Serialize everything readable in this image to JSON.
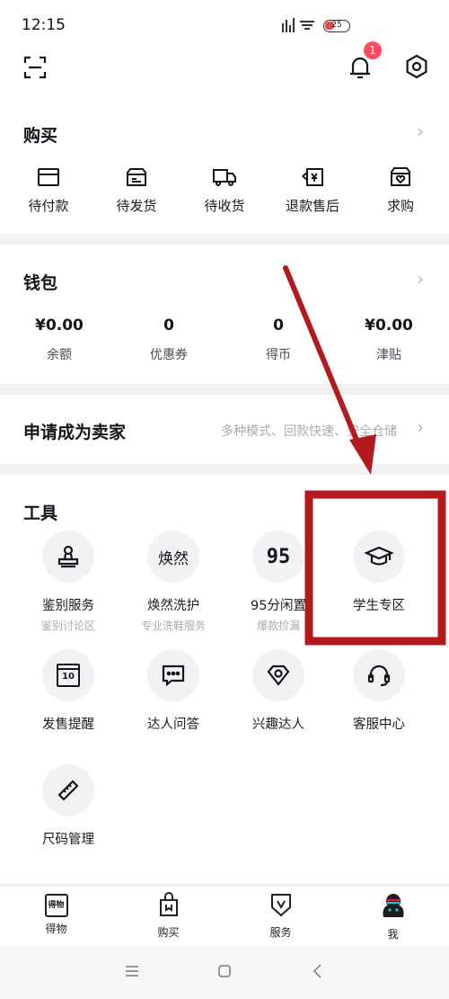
{
  "status_bar": {
    "time": "12:15",
    "battery": "25"
  },
  "header": {
    "scan_icon": "scan-icon",
    "bell_icon": "bell-icon",
    "notification_count": "1",
    "settings_icon": "gear-icon"
  },
  "buy": {
    "title": "购买",
    "items": [
      {
        "label": "待付款",
        "icon": "card-icon"
      },
      {
        "label": "待发货",
        "icon": "box-icon"
      },
      {
        "label": "待收货",
        "icon": "truck-icon"
      },
      {
        "label": "退款售后",
        "icon": "refund-icon"
      },
      {
        "label": "求购",
        "icon": "heart-bag-icon"
      }
    ]
  },
  "wallet": {
    "title": "钱包",
    "items": [
      {
        "value": "¥0.00",
        "label": "余额"
      },
      {
        "value": "0",
        "label": "优惠券"
      },
      {
        "value": "0",
        "label": "得币"
      },
      {
        "value": "¥0.00",
        "label": "津贴"
      }
    ]
  },
  "seller": {
    "title": "申请成为卖家",
    "desc": "多种模式、回款快速、安全仓储"
  },
  "tools": {
    "title": "工具",
    "items": [
      {
        "label": "鉴别服务",
        "sub": "鉴别讨论区",
        "icon": "stamp-icon"
      },
      {
        "label": "焕然洗护",
        "sub": "专业洗鞋服务",
        "icon": "huanran-logo",
        "logo_text": "焕然"
      },
      {
        "label": "95分闲置",
        "sub": "爆款捡漏",
        "icon": "95-logo",
        "logo_text": "95"
      },
      {
        "label": "学生专区",
        "sub": "",
        "icon": "graduation-cap-icon"
      },
      {
        "label": "发售提醒",
        "sub": "",
        "icon": "calendar-icon",
        "logo_text": "10"
      },
      {
        "label": "达人问答",
        "sub": "",
        "icon": "chat-icon"
      },
      {
        "label": "兴趣达人",
        "sub": "",
        "icon": "diamond-icon"
      },
      {
        "label": "客服中心",
        "sub": "",
        "icon": "headset-icon"
      },
      {
        "label": "尺码管理",
        "sub": "",
        "icon": "ruler-icon"
      }
    ]
  },
  "tabbar": [
    {
      "label": "得物",
      "icon": "dewu-logo-icon",
      "logo_text": "得物"
    },
    {
      "label": "购买",
      "icon": "shopping-bag-icon"
    },
    {
      "label": "服务",
      "icon": "shield-v-icon"
    },
    {
      "label": "我",
      "icon": "avatar-icon"
    }
  ],
  "annotation": {
    "color": "#b3191d"
  },
  "nav": {
    "menu_icon": "menu-icon",
    "home_icon": "home-icon",
    "back_icon": "back-icon"
  }
}
